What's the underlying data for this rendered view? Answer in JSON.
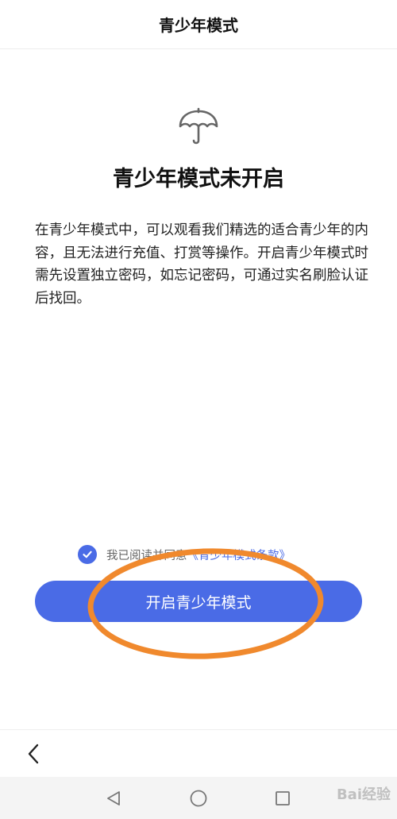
{
  "header": {
    "title": "青少年模式"
  },
  "hero": {
    "icon": "umbrella-icon",
    "title": "青少年模式未开启",
    "description": "在青少年模式中，可以观看我们精选的适合青少年的内容，且无法进行充值、打赏等操作。开启青少年模式时需先设置独立密码，如忘记密码，可通过实名刷脸认证后找回。"
  },
  "agreement": {
    "checked": true,
    "text": "我已阅读并同意",
    "link_text": "《青少年模式条款》"
  },
  "primary_button": {
    "label": "开启青少年模式"
  },
  "annotation": {
    "shape": "ellipse",
    "color": "#f0892d"
  },
  "bottom_bar": {
    "back_icon": "chevron-left-icon"
  },
  "system_nav": {
    "icons": [
      "triangle-back-icon",
      "circle-home-icon",
      "square-recents-icon"
    ]
  },
  "watermark": {
    "text": "Bai经验"
  },
  "colors": {
    "accent": "#4a6be6",
    "annotation": "#f0892d"
  }
}
